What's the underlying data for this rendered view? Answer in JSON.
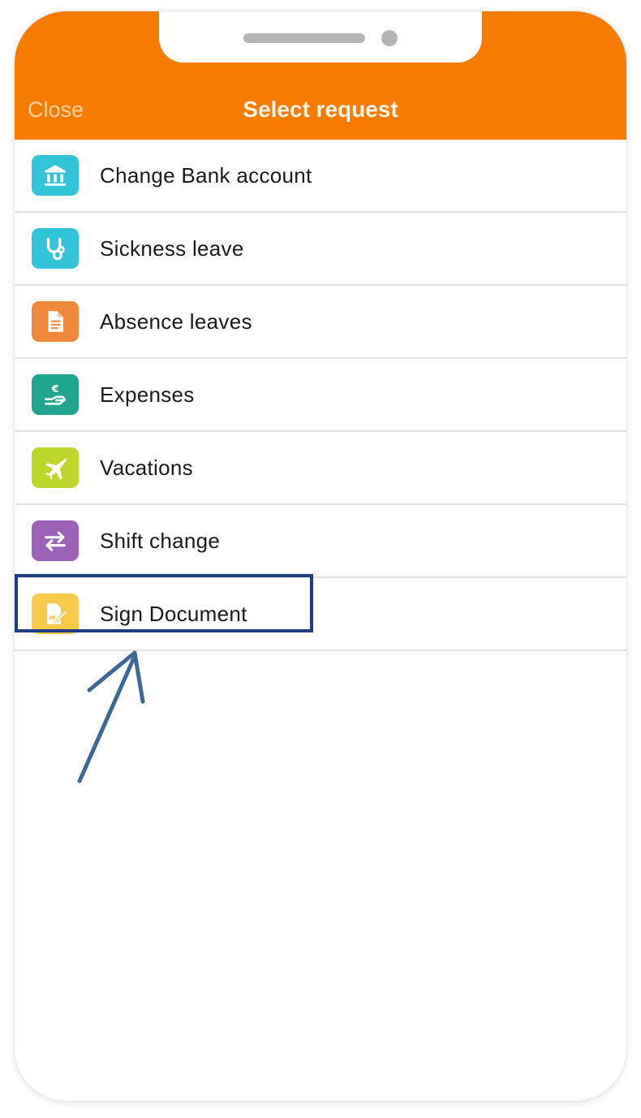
{
  "header": {
    "close_label": "Close",
    "title": "Select request",
    "bar_color": "#f57c00"
  },
  "requests": [
    {
      "label": "Change Bank account",
      "icon": "bank-icon",
      "color": "#31c3d8"
    },
    {
      "label": "Sickness leave",
      "icon": "stethoscope-icon",
      "color": "#31c3d8"
    },
    {
      "label": "Absence leaves",
      "icon": "document-icon",
      "color": "#f0883a"
    },
    {
      "label": "Expenses",
      "icon": "euro-hand-icon",
      "color": "#22a58f"
    },
    {
      "label": "Vacations",
      "icon": "airplane-icon",
      "color": "#bfd72c"
    },
    {
      "label": "Shift change",
      "icon": "swap-arrows-icon",
      "color": "#9b62b8"
    },
    {
      "label": "Sign Document",
      "icon": "sign-document-icon",
      "color": "#f7c948"
    }
  ],
  "annotation": {
    "highlighted_item": "Sign Document",
    "box_color": "#1f3d85",
    "arrow_color": "#3d6896"
  }
}
